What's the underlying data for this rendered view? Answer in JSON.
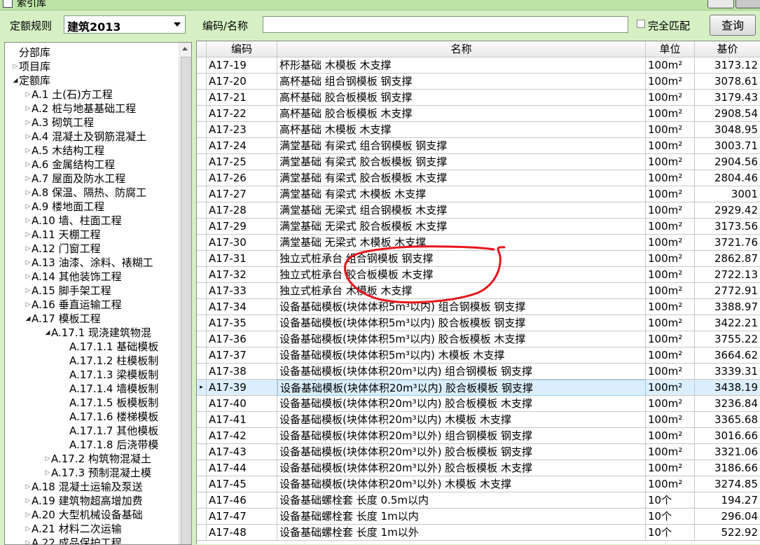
{
  "window": {
    "title": "索引库"
  },
  "left": {
    "rule_label": "定额规则",
    "rule_value": "建筑2013",
    "tree": [
      {
        "label": "分部库",
        "level": 0,
        "toggle": "none"
      },
      {
        "label": "项目库",
        "level": 0,
        "toggle": "closed"
      },
      {
        "label": "定额库",
        "level": 0,
        "toggle": "open"
      },
      {
        "label": "A.1 土(石)方工程",
        "level": 1,
        "toggle": "closed"
      },
      {
        "label": "A.2 桩与地基基础工程",
        "level": 1,
        "toggle": "closed"
      },
      {
        "label": "A.3 砌筑工程",
        "level": 1,
        "toggle": "closed"
      },
      {
        "label": "A.4 混凝土及钢筋混凝土",
        "level": 1,
        "toggle": "closed"
      },
      {
        "label": "A.5 木结构工程",
        "level": 1,
        "toggle": "closed"
      },
      {
        "label": "A.6 金属结构工程",
        "level": 1,
        "toggle": "closed"
      },
      {
        "label": "A.7 屋面及防水工程",
        "level": 1,
        "toggle": "closed"
      },
      {
        "label": "A.8 保温、隔热、防腐工",
        "level": 1,
        "toggle": "closed"
      },
      {
        "label": "A.9 楼地面工程",
        "level": 1,
        "toggle": "closed"
      },
      {
        "label": "A.10 墙、柱面工程",
        "level": 1,
        "toggle": "closed"
      },
      {
        "label": "A.11 天棚工程",
        "level": 1,
        "toggle": "closed"
      },
      {
        "label": "A.12 门窗工程",
        "level": 1,
        "toggle": "closed"
      },
      {
        "label": "A.13 油漆、涂料、裱糊工",
        "level": 1,
        "toggle": "closed"
      },
      {
        "label": "A.14 其他装饰工程",
        "level": 1,
        "toggle": "closed"
      },
      {
        "label": "A.15 脚手架工程",
        "level": 1,
        "toggle": "closed"
      },
      {
        "label": "A.16 垂直运输工程",
        "level": 1,
        "toggle": "closed"
      },
      {
        "label": "A.17 模板工程",
        "level": 1,
        "toggle": "open"
      },
      {
        "label": "A.17.1 现浇建筑物混",
        "level": 2,
        "toggle": "open"
      },
      {
        "label": "A.17.1.1 基础模板",
        "level": 3,
        "toggle": "none"
      },
      {
        "label": "A.17.1.2 柱模板制",
        "level": 3,
        "toggle": "none"
      },
      {
        "label": "A.17.1.3 梁模板制",
        "level": 3,
        "toggle": "none"
      },
      {
        "label": "A.17.1.4 墙模板制",
        "level": 3,
        "toggle": "none"
      },
      {
        "label": "A.17.1.5 板模板制",
        "level": 3,
        "toggle": "none"
      },
      {
        "label": "A.17.1.6 楼梯模板",
        "level": 3,
        "toggle": "none"
      },
      {
        "label": "A.17.1.7 其他模板",
        "level": 3,
        "toggle": "none"
      },
      {
        "label": "A.17.1.8 后浇带模",
        "level": 3,
        "toggle": "none"
      },
      {
        "label": "A.17.2 构筑物混凝土",
        "level": 2,
        "toggle": "closed"
      },
      {
        "label": "A.17.3 预制混凝土模",
        "level": 2,
        "toggle": "closed"
      },
      {
        "label": "A.18 混凝土运输及泵送",
        "level": 1,
        "toggle": "closed"
      },
      {
        "label": "A.19 建筑物超高增加费",
        "level": 1,
        "toggle": "closed"
      },
      {
        "label": "A.20 大型机械设备基础",
        "level": 1,
        "toggle": "closed"
      },
      {
        "label": "A.21 材料二次运输",
        "level": 1,
        "toggle": "closed"
      },
      {
        "label": "A.22 成品保护工程",
        "level": 1,
        "toggle": "closed"
      }
    ]
  },
  "search": {
    "label": "编码/名称",
    "value": "",
    "exact_label": "完全匹配",
    "query_button": "查询"
  },
  "grid": {
    "headers": [
      "编码",
      "名称",
      "单位",
      "基价"
    ],
    "selected_row": 20,
    "rows": [
      {
        "code": "A17-19",
        "name": "杯形基础 木模板 木支撑",
        "unit": "100m²",
        "price": "3173.12"
      },
      {
        "code": "A17-20",
        "name": "高杯基础 组合钢模板 钢支撑",
        "unit": "100m²",
        "price": "3078.61"
      },
      {
        "code": "A17-21",
        "name": "高杯基础 胶合板模板 钢支撑",
        "unit": "100m²",
        "price": "3179.43"
      },
      {
        "code": "A17-22",
        "name": "高杯基础 胶合板模板 木支撑",
        "unit": "100m²",
        "price": "2908.54"
      },
      {
        "code": "A17-23",
        "name": "高杯基础 木模板 木支撑",
        "unit": "100m²",
        "price": "3048.95"
      },
      {
        "code": "A17-24",
        "name": "满堂基础 有梁式 组合钢模板 钢支撑",
        "unit": "100m²",
        "price": "3003.71"
      },
      {
        "code": "A17-25",
        "name": "满堂基础 有梁式 胶合板模板 钢支撑",
        "unit": "100m²",
        "price": "2904.56"
      },
      {
        "code": "A17-26",
        "name": "满堂基础 有梁式 胶合板模板 木支撑",
        "unit": "100m²",
        "price": "2804.46"
      },
      {
        "code": "A17-27",
        "name": "满堂基础 有梁式 木模板 木支撑",
        "unit": "100m²",
        "price": "3001"
      },
      {
        "code": "A17-28",
        "name": "满堂基础 无梁式 组合钢模板 木支撑",
        "unit": "100m²",
        "price": "2929.42"
      },
      {
        "code": "A17-29",
        "name": "满堂基础 无梁式 胶合板模板 木支撑",
        "unit": "100m²",
        "price": "3173.56"
      },
      {
        "code": "A17-30",
        "name": "满堂基础 无梁式 木模板 木支撑",
        "unit": "100m²",
        "price": "3721.76"
      },
      {
        "code": "A17-31",
        "name": "独立式桩承台 组合钢模板 钢支撑",
        "unit": "100m²",
        "price": "2862.87"
      },
      {
        "code": "A17-32",
        "name": "独立式桩承台 胶合板模板 木支撑",
        "unit": "100m²",
        "price": "2722.13"
      },
      {
        "code": "A17-33",
        "name": "独立式桩承台 木模板 木支撑",
        "unit": "100m²",
        "price": "2772.91"
      },
      {
        "code": "A17-34",
        "name": "设备基础模板(块体体积5m³以内) 组合钢模板 钢支撑",
        "unit": "100m²",
        "price": "3388.97"
      },
      {
        "code": "A17-35",
        "name": "设备基础模板(块体体积5m³以内) 胶合板模板 钢支撑",
        "unit": "100m²",
        "price": "3422.21"
      },
      {
        "code": "A17-36",
        "name": "设备基础模板(块体体积5m³以内) 胶合板模板 木支撑",
        "unit": "100m²",
        "price": "3755.22"
      },
      {
        "code": "A17-37",
        "name": "设备基础模板(块体体积5m³以内) 木模板 木支撑",
        "unit": "100m²",
        "price": "3664.62"
      },
      {
        "code": "A17-38",
        "name": "设备基础模板(块体体积20m³以内) 组合钢模板 钢支撑",
        "unit": "100m²",
        "price": "3339.31"
      },
      {
        "code": "A17-39",
        "name": "设备基础模板(块体体积20m³以内) 胶合板模板 钢支撑",
        "unit": "100m²",
        "price": "3438.19"
      },
      {
        "code": "A17-40",
        "name": "设备基础模板(块体体积20m³以内) 胶合板模板 木支撑",
        "unit": "100m²",
        "price": "3236.84"
      },
      {
        "code": "A17-41",
        "name": "设备基础模板(块体体积20m³以内) 木模板 木支撑",
        "unit": "100m²",
        "price": "3365.68"
      },
      {
        "code": "A17-42",
        "name": "设备基础模板(块体体积20m³以外) 组合钢模板 钢支撑",
        "unit": "100m²",
        "price": "3016.66"
      },
      {
        "code": "A17-43",
        "name": "设备基础模板(块体体积20m³以外) 胶合板模板 钢支撑",
        "unit": "100m²",
        "price": "3321.06"
      },
      {
        "code": "A17-44",
        "name": "设备基础模板(块体体积20m³以外) 胶合板模板 木支撑",
        "unit": "100m²",
        "price": "3186.66"
      },
      {
        "code": "A17-45",
        "name": "设备基础模板(块体体积20m³以外) 木模板 木支撑",
        "unit": "100m²",
        "price": "3274.85"
      },
      {
        "code": "A17-46",
        "name": "设备基础螺栓套 长度 0.5m以内",
        "unit": "10个",
        "price": "194.27"
      },
      {
        "code": "A17-47",
        "name": "设备基础螺栓套 长度 1m以内",
        "unit": "10个",
        "price": "296.04"
      },
      {
        "code": "A17-48",
        "name": "设备基础螺栓套 长度 1m以外",
        "unit": "10个",
        "price": "522.92"
      }
    ]
  },
  "colors": {
    "window_bg": "#d6f0c4",
    "selection": "#dbeefd",
    "annotation": "#e8141c"
  }
}
